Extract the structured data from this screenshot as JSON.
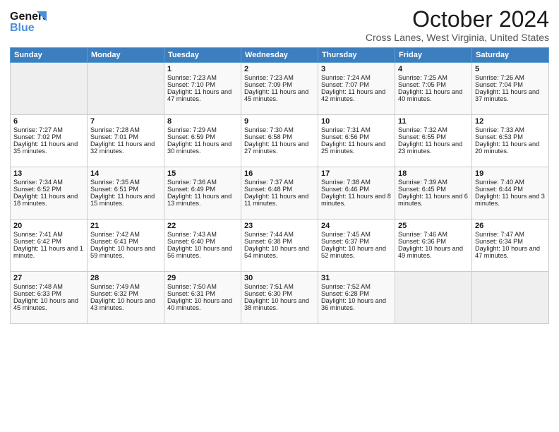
{
  "header": {
    "logo_line1": "General",
    "logo_line2": "Blue",
    "month_title": "October 2024",
    "subtitle": "Cross Lanes, West Virginia, United States"
  },
  "days_of_week": [
    "Sunday",
    "Monday",
    "Tuesday",
    "Wednesday",
    "Thursday",
    "Friday",
    "Saturday"
  ],
  "weeks": [
    [
      {
        "day": "",
        "empty": true
      },
      {
        "day": "",
        "empty": true
      },
      {
        "day": "1",
        "sunrise": "7:23 AM",
        "sunset": "7:10 PM",
        "daylight": "11 hours and 47 minutes."
      },
      {
        "day": "2",
        "sunrise": "7:23 AM",
        "sunset": "7:09 PM",
        "daylight": "11 hours and 45 minutes."
      },
      {
        "day": "3",
        "sunrise": "7:24 AM",
        "sunset": "7:07 PM",
        "daylight": "11 hours and 42 minutes."
      },
      {
        "day": "4",
        "sunrise": "7:25 AM",
        "sunset": "7:05 PM",
        "daylight": "11 hours and 40 minutes."
      },
      {
        "day": "5",
        "sunrise": "7:26 AM",
        "sunset": "7:04 PM",
        "daylight": "11 hours and 37 minutes."
      }
    ],
    [
      {
        "day": "6",
        "sunrise": "7:27 AM",
        "sunset": "7:02 PM",
        "daylight": "11 hours and 35 minutes."
      },
      {
        "day": "7",
        "sunrise": "7:28 AM",
        "sunset": "7:01 PM",
        "daylight": "11 hours and 32 minutes."
      },
      {
        "day": "8",
        "sunrise": "7:29 AM",
        "sunset": "6:59 PM",
        "daylight": "11 hours and 30 minutes."
      },
      {
        "day": "9",
        "sunrise": "7:30 AM",
        "sunset": "6:58 PM",
        "daylight": "11 hours and 27 minutes."
      },
      {
        "day": "10",
        "sunrise": "7:31 AM",
        "sunset": "6:56 PM",
        "daylight": "11 hours and 25 minutes."
      },
      {
        "day": "11",
        "sunrise": "7:32 AM",
        "sunset": "6:55 PM",
        "daylight": "11 hours and 23 minutes."
      },
      {
        "day": "12",
        "sunrise": "7:33 AM",
        "sunset": "6:53 PM",
        "daylight": "11 hours and 20 minutes."
      }
    ],
    [
      {
        "day": "13",
        "sunrise": "7:34 AM",
        "sunset": "6:52 PM",
        "daylight": "11 hours and 18 minutes."
      },
      {
        "day": "14",
        "sunrise": "7:35 AM",
        "sunset": "6:51 PM",
        "daylight": "11 hours and 15 minutes."
      },
      {
        "day": "15",
        "sunrise": "7:36 AM",
        "sunset": "6:49 PM",
        "daylight": "11 hours and 13 minutes."
      },
      {
        "day": "16",
        "sunrise": "7:37 AM",
        "sunset": "6:48 PM",
        "daylight": "11 hours and 11 minutes."
      },
      {
        "day": "17",
        "sunrise": "7:38 AM",
        "sunset": "6:46 PM",
        "daylight": "11 hours and 8 minutes."
      },
      {
        "day": "18",
        "sunrise": "7:39 AM",
        "sunset": "6:45 PM",
        "daylight": "11 hours and 6 minutes."
      },
      {
        "day": "19",
        "sunrise": "7:40 AM",
        "sunset": "6:44 PM",
        "daylight": "11 hours and 3 minutes."
      }
    ],
    [
      {
        "day": "20",
        "sunrise": "7:41 AM",
        "sunset": "6:42 PM",
        "daylight": "11 hours and 1 minute."
      },
      {
        "day": "21",
        "sunrise": "7:42 AM",
        "sunset": "6:41 PM",
        "daylight": "10 hours and 59 minutes."
      },
      {
        "day": "22",
        "sunrise": "7:43 AM",
        "sunset": "6:40 PM",
        "daylight": "10 hours and 56 minutes."
      },
      {
        "day": "23",
        "sunrise": "7:44 AM",
        "sunset": "6:38 PM",
        "daylight": "10 hours and 54 minutes."
      },
      {
        "day": "24",
        "sunrise": "7:45 AM",
        "sunset": "6:37 PM",
        "daylight": "10 hours and 52 minutes."
      },
      {
        "day": "25",
        "sunrise": "7:46 AM",
        "sunset": "6:36 PM",
        "daylight": "10 hours and 49 minutes."
      },
      {
        "day": "26",
        "sunrise": "7:47 AM",
        "sunset": "6:34 PM",
        "daylight": "10 hours and 47 minutes."
      }
    ],
    [
      {
        "day": "27",
        "sunrise": "7:48 AM",
        "sunset": "6:33 PM",
        "daylight": "10 hours and 45 minutes."
      },
      {
        "day": "28",
        "sunrise": "7:49 AM",
        "sunset": "6:32 PM",
        "daylight": "10 hours and 43 minutes."
      },
      {
        "day": "29",
        "sunrise": "7:50 AM",
        "sunset": "6:31 PM",
        "daylight": "10 hours and 40 minutes."
      },
      {
        "day": "30",
        "sunrise": "7:51 AM",
        "sunset": "6:30 PM",
        "daylight": "10 hours and 38 minutes."
      },
      {
        "day": "31",
        "sunrise": "7:52 AM",
        "sunset": "6:28 PM",
        "daylight": "10 hours and 36 minutes."
      },
      {
        "day": "",
        "empty": true
      },
      {
        "day": "",
        "empty": true
      }
    ]
  ],
  "labels": {
    "sunrise": "Sunrise:",
    "sunset": "Sunset:",
    "daylight": "Daylight:"
  }
}
